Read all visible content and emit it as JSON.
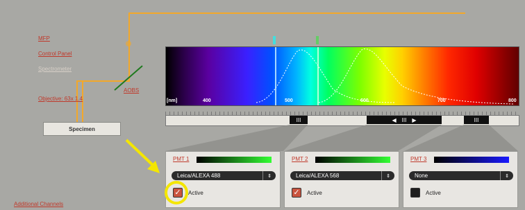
{
  "nav": {
    "mfp": "MFP",
    "control_panel": "Control Panel",
    "spectrometer": "Spectrometer",
    "objective": "Objective: 63x 1.4",
    "aobs": "AOBS",
    "additional_channels": "Additional Channels"
  },
  "specimen_label": "Specimen",
  "spectrum": {
    "unit_label": "[nm]",
    "ticks": [
      "400",
      "500",
      "600",
      "700",
      "800"
    ]
  },
  "slider": {
    "handle_grip": "III",
    "left_arrow": "◀",
    "right_arrow": "▶"
  },
  "pmt_channels": [
    {
      "title": "PMT 1",
      "dye": "Leica/ALEXA 488",
      "active_label": "Active",
      "active": true,
      "color": "#33ff33"
    },
    {
      "title": "PMT 2",
      "dye": "Leica/ALEXA 568",
      "active_label": "Active",
      "active": true,
      "color": "#33ff33"
    },
    {
      "title": "PMT 3",
      "dye": "None",
      "active_label": "Active",
      "active": false,
      "color": "#1a1aff"
    }
  ],
  "dropdown_arrow_glyph": "⇕",
  "accent_colors": {
    "beam": "#f3a82a",
    "link": "#c0392b",
    "annotation": "#f4e600"
  }
}
